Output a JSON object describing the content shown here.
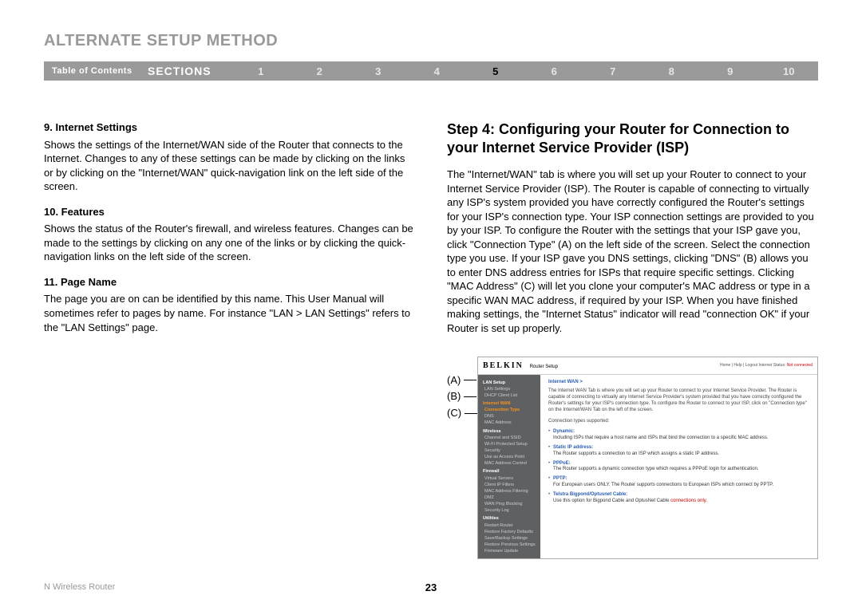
{
  "title": "ALTERNATE SETUP METHOD",
  "nav": {
    "toc": "Table of Contents",
    "sections": "SECTIONS",
    "nums": [
      "1",
      "2",
      "3",
      "4",
      "5",
      "6",
      "7",
      "8",
      "9",
      "10"
    ],
    "current": "5"
  },
  "left": {
    "h1": "9.  Internet Settings",
    "p1": "Shows the settings of the Internet/WAN side of the Router that connects to the Internet. Changes to any of these settings can be made by clicking on the links or by clicking on the \"Internet/WAN\" quick-navigation link on the left side of the screen.",
    "h2": "10.  Features",
    "p2": "Shows the status of the Router's firewall, and wireless features. Changes can be made to the settings by clicking on any one of the links or by clicking the quick-navigation links on the left side of the screen.",
    "h3": "11.  Page Name",
    "p3": "The page you are on can be identified by this name. This User Manual will sometimes refer to pages by name. For instance \"LAN > LAN Settings\" refers to the \"LAN Settings\" page."
  },
  "right": {
    "step_title": "Step 4: Configuring your Router for Connection to your Internet Service Provider (ISP)",
    "body": "The \"Internet/WAN\" tab is where you will set up your Router to connect to your Internet Service Provider (ISP). The Router is capable of connecting to virtually any ISP's system provided you have correctly configured the Router's settings for your ISP's connection type. Your ISP connection settings are provided to you by your ISP. To configure the Router with the settings that your ISP gave you, click \"Connection Type\" (A) on the left side of the screen. Select the connection type you use. If your ISP gave you DNS settings, clicking \"DNS\" (B) allows you to enter DNS address entries for ISPs that require specific settings. Clicking \"MAC Address\" (C) will let you clone your computer's MAC address or type in a specific WAN MAC address, if required by your ISP. When you have finished making settings, the \"Internet Status\" indicator will read \"connection OK\" if your Router is set up properly."
  },
  "callouts": {
    "a": "(A)",
    "b": "(B)",
    "c": "(C)"
  },
  "shot": {
    "logo": "BELKIN",
    "logo_sub": "Router Setup",
    "status_left": "Home | Help | Logout   Internet Status:",
    "status_red": "Not connected",
    "crumb": "Internet WAN >",
    "intro1": "The Internet WAN Tab is where you will set up your Router to connect to your Internet Service Provider. The Router is capable of connecting to virtually any Internet Service Provider's system provided that you have correctly configured the Router's settings for your ISP's connection type. To configure the Router to connect to your ISP, click on \"Connection type\" on the Internet/WAN Tab on the left of the screen.",
    "supported": "Connection types supported:",
    "li1b": "Dynamic:",
    "li1": "Including ISPs that require a host name and ISPs that bind the connection to a specific MAC address.",
    "li2b": "Static IP address:",
    "li2": "The Router supports a connection to an ISP which assigns a static IP address.",
    "li3b": "PPPoE:",
    "li3": "The Router supports a dynamic connection type which requires a PPPoE login for authentication.",
    "li4b": "PPTP:",
    "li4": "For European users ONLY. The Router supports connections to European ISPs which connect by PPTP.",
    "li5b": "Telstra Bigpond/Optusnet Cable:",
    "li5a": "Use this option for Bigpond Cable and OptusNet Cable",
    "li5r": " connections only.",
    "side": {
      "cat1": "LAN Setup",
      "i1": "LAN Settings",
      "i2": "DHCP Client List",
      "cat2": "Internet WAN",
      "i3": "Connection Type",
      "i4": "DNS",
      "i5": "MAC Address",
      "cat3": "Wireless",
      "i6": "Channel and SSID",
      "i7": "Wi-Fi Protected Setup",
      "i8": "Security",
      "i9": "Use as Access Point",
      "i10": "MAC Address Control",
      "cat4": "Firewall",
      "i11": "Virtual Servers",
      "i12": "Client IP Filters",
      "i13": "MAC Address Filtering",
      "i14": "DMZ",
      "i15": "WAN Ping Blocking",
      "i16": "Security Log",
      "cat5": "Utilities",
      "i17": "Restart Router",
      "i18": "Restore Factory Defaults",
      "i19": "Save/Backup Settings",
      "i20": "Restore Previous Settings",
      "i21": "Firmware Update"
    }
  },
  "footer": {
    "product": "N Wireless Router",
    "page": "23"
  }
}
